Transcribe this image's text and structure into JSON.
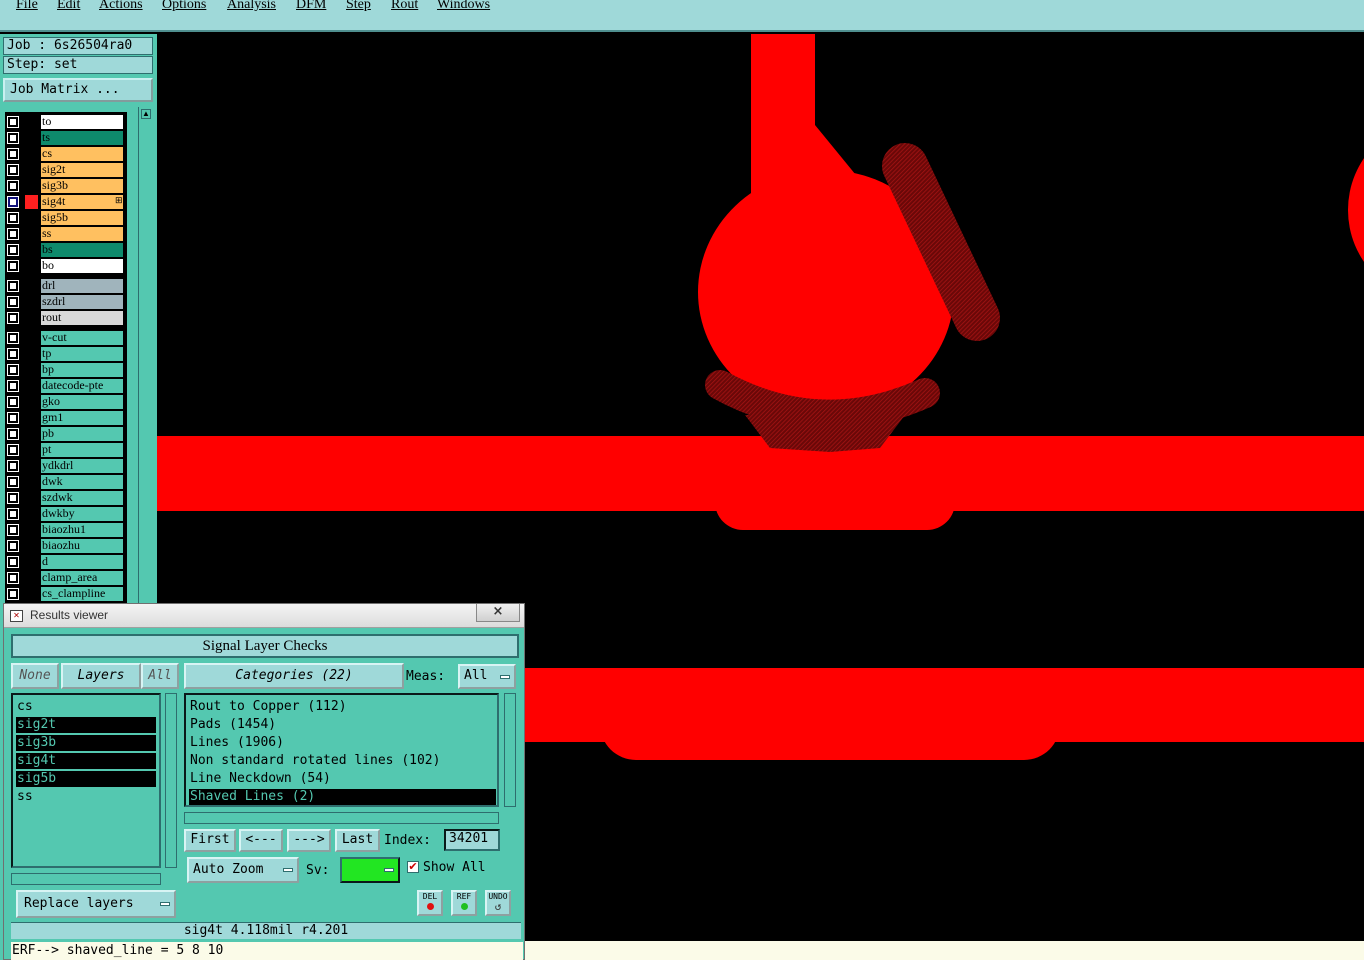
{
  "menu": [
    "File",
    "Edit",
    "Actions",
    "Options",
    "Analysis",
    "DFM",
    "Step",
    "Rout",
    "Windows"
  ],
  "job": {
    "job_line": "Job : 6s26504ra0",
    "step_line": "Step: set",
    "matrix_button": "Job Matrix ..."
  },
  "layers": [
    {
      "name": "to",
      "color": "#ffffff"
    },
    {
      "name": "ts",
      "color": "#0e8a6c"
    },
    {
      "name": "cs",
      "color": "#ffc060"
    },
    {
      "name": "sig2t",
      "color": "#ffc060"
    },
    {
      "name": "sig3b",
      "color": "#ffc060"
    },
    {
      "name": "sig4t",
      "color": "#ffc060",
      "selected": true,
      "display_color": "#ff2020"
    },
    {
      "name": "sig5b",
      "color": "#ffc060"
    },
    {
      "name": "ss",
      "color": "#ffc060"
    },
    {
      "name": "bs",
      "color": "#0e8a6c"
    },
    {
      "name": "bo",
      "color": "#ffffff"
    },
    {
      "name": "drl",
      "color": "#a0b4bc"
    },
    {
      "name": "szdrl",
      "color": "#a0b4bc"
    },
    {
      "name": "rout",
      "color": "#d8d8d8"
    },
    {
      "name": "v-cut",
      "color": "#54c8b0"
    },
    {
      "name": "tp",
      "color": "#54c8b0"
    },
    {
      "name": "bp",
      "color": "#54c8b0"
    },
    {
      "name": "datecode-pte",
      "color": "#54c8b0"
    },
    {
      "name": "gko",
      "color": "#54c8b0"
    },
    {
      "name": "gm1",
      "color": "#54c8b0"
    },
    {
      "name": "pb",
      "color": "#54c8b0"
    },
    {
      "name": "pt",
      "color": "#54c8b0"
    },
    {
      "name": "ydkdrl",
      "color": "#54c8b0"
    },
    {
      "name": "dwk",
      "color": "#54c8b0"
    },
    {
      "name": "szdwk",
      "color": "#54c8b0"
    },
    {
      "name": "dwkby",
      "color": "#54c8b0"
    },
    {
      "name": "biaozhu1",
      "color": "#54c8b0"
    },
    {
      "name": "biaozhu",
      "color": "#54c8b0"
    },
    {
      "name": "d",
      "color": "#54c8b0"
    },
    {
      "name": "clamp_area",
      "color": "#54c8b0"
    },
    {
      "name": "cs_clampline",
      "color": "#54c8b0"
    }
  ],
  "results_viewer": {
    "title": "Results viewer",
    "close_symbol": "×",
    "header": "Signal Layer Checks",
    "none_button": "None",
    "layers_button": "Layers",
    "all_button": "All",
    "categories_button": "Categories (22)",
    "meas_label": "Meas:",
    "meas_value": "All",
    "layer_items": [
      {
        "name": "cs",
        "selected": false
      },
      {
        "name": "sig2t",
        "selected": true
      },
      {
        "name": "sig3b",
        "selected": true
      },
      {
        "name": "sig4t",
        "selected": true
      },
      {
        "name": "sig5b",
        "selected": true
      },
      {
        "name": "ss",
        "selected": false
      }
    ],
    "category_items": [
      {
        "name": "Rout to Copper (112)",
        "selected": false
      },
      {
        "name": "Pads (1454)",
        "selected": false
      },
      {
        "name": "Lines (1906)",
        "selected": false
      },
      {
        "name": "Non standard rotated lines (102)",
        "selected": false
      },
      {
        "name": "Line Neckdown (54)",
        "selected": false
      },
      {
        "name": "Shaved Lines (2)",
        "selected": true
      }
    ],
    "first_button": "First",
    "prev_button": "<---",
    "next_button": "--->",
    "last_button": "Last",
    "index_label": "Index:",
    "index_value": "34201",
    "auto_zoom": "Auto Zoom",
    "sv_label": "Sv:",
    "sv_color": "#22e622",
    "show_all_label": "Show All",
    "show_all_checked": true,
    "replace_layers": "Replace layers",
    "del_label": "DEL",
    "ref_label": "REF",
    "undo_label": "UNDO",
    "status": "sig4t 4.118mil  r4.201",
    "erf_line": "ERF--> shaved_line = 5 8 10"
  },
  "colors": {
    "copper": "#ff0000",
    "hatch": "#7a0a0a",
    "panel": "#54c8b0",
    "panel_light": "#9fd9d9"
  }
}
